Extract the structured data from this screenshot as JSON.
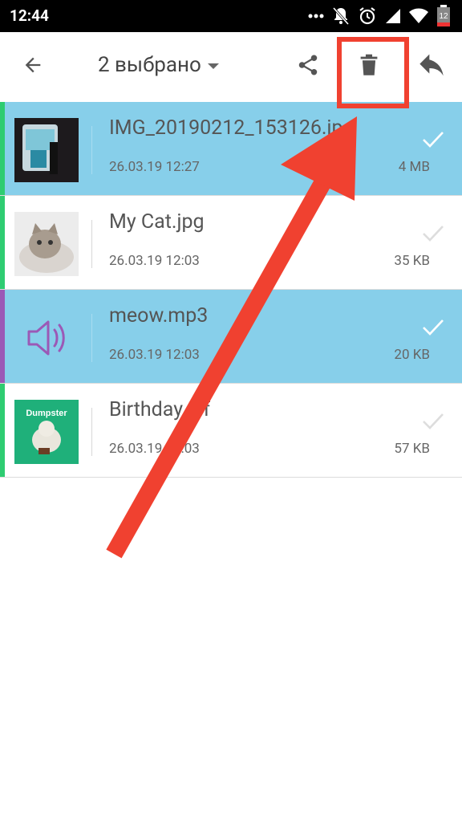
{
  "status_bar": {
    "time": "12:44",
    "battery_level": "12"
  },
  "toolbar": {
    "title": "2 выбрано"
  },
  "files": [
    {
      "name": "IMG_20190212_153126.jpg",
      "date": "26.03.19 12:27",
      "size": "4 MB",
      "selected": true,
      "accent": "#2ecc71"
    },
    {
      "name": "My Cat.jpg",
      "date": "26.03.19 12:03",
      "size": "35 KB",
      "selected": false,
      "accent": "#2ecc71"
    },
    {
      "name": "meow.mp3",
      "date": "26.03.19 12:03",
      "size": "20 KB",
      "selected": true,
      "accent": "#9b59b6"
    },
    {
      "name": "Birthday.gif",
      "date": "26.03.19 12:03",
      "size": "57 KB",
      "selected": false,
      "accent": "#2ecc71"
    }
  ],
  "thumbnails": {
    "birthday_caption": "Dumpster"
  },
  "colors": {
    "selected_row": "#87cfea",
    "annotation_red": "#f04130",
    "audio_icon": "#9b59b6"
  }
}
